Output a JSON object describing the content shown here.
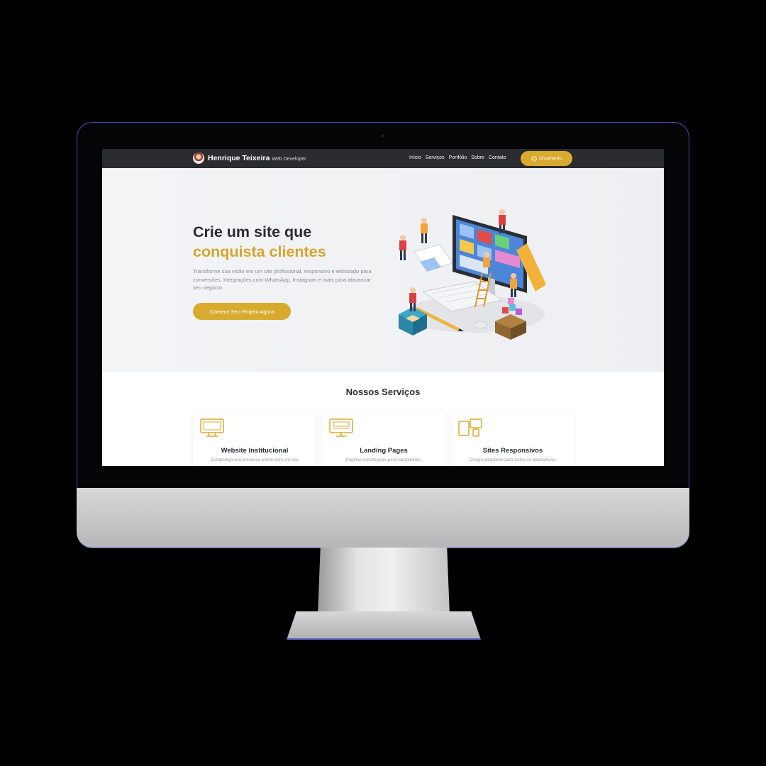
{
  "colors": {
    "accent": "#d8ab2f",
    "navbar": "#2a2c30",
    "text_dark": "#2a2c30"
  },
  "navbar": {
    "brand_name": "Henrique Teixeira",
    "brand_subtitle": "Web Developer",
    "links": [
      "Início",
      "Serviços",
      "Portfólio",
      "Sobre",
      "Contato"
    ],
    "cta_icon": "whatsapp-icon",
    "cta_label": "Orçamento"
  },
  "hero": {
    "title_line1": "Crie um site que",
    "title_line2": "conquista clientes",
    "description": "Transforme sua visão em um site profissional, responsivo e otimizado para conversões. Integrações com WhatsApp, Instagram e mais para alavancar seu negócio.",
    "button_label": "Comece Seu Projeto Agora",
    "illustration": "isometric-web-development-illustration"
  },
  "services": {
    "title": "Nossos Serviços",
    "cards": [
      {
        "icon": "monitor-icon",
        "title": "Website Institucional",
        "description": "Estabeleça sua presença online com um site"
      },
      {
        "icon": "landing-page-icon",
        "title": "Landing Pages",
        "description": "Páginas estratégicas para campanhas,"
      },
      {
        "icon": "devices-icon",
        "title": "Sites Responsivos",
        "description": "Design adaptável para todos os dispositivos,"
      }
    ]
  }
}
